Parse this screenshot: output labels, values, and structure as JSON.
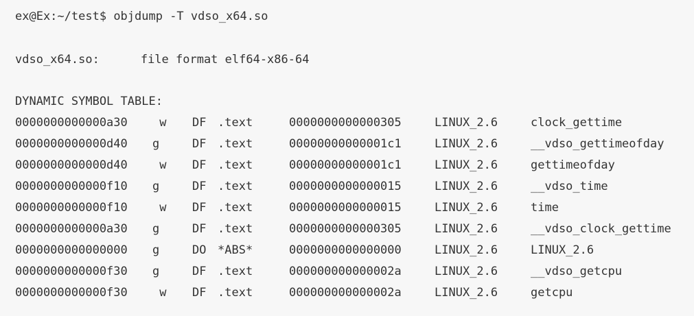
{
  "terminal": {
    "prompt": "ex@Ex:~/test$",
    "command": "objdump -T vdso_x64.so",
    "file_name": "vdso_x64.so:",
    "file_format": "file format elf64-x86-64",
    "table_title": "DYNAMIC SYMBOL TABLE:",
    "rows": [
      {
        "addr": "0000000000000a30",
        "flag1": " w",
        "flag2": "DF",
        "section": ".text",
        "size": "0000000000000305",
        "version": "LINUX_2.6",
        "name": "clock_gettime"
      },
      {
        "addr": "0000000000000d40",
        "flag1": "g",
        "flag2": "DF",
        "section": ".text",
        "size": "00000000000001c1",
        "version": "LINUX_2.6",
        "name": "__vdso_gettimeofday"
      },
      {
        "addr": "0000000000000d40",
        "flag1": " w",
        "flag2": "DF",
        "section": ".text",
        "size": "00000000000001c1",
        "version": "LINUX_2.6",
        "name": "gettimeofday"
      },
      {
        "addr": "0000000000000f10",
        "flag1": "g",
        "flag2": "DF",
        "section": ".text",
        "size": "0000000000000015",
        "version": "LINUX_2.6",
        "name": "__vdso_time"
      },
      {
        "addr": "0000000000000f10",
        "flag1": " w",
        "flag2": "DF",
        "section": ".text",
        "size": "0000000000000015",
        "version": "LINUX_2.6",
        "name": "time"
      },
      {
        "addr": "0000000000000a30",
        "flag1": "g",
        "flag2": "DF",
        "section": ".text",
        "size": "0000000000000305",
        "version": "LINUX_2.6",
        "name": "__vdso_clock_gettime"
      },
      {
        "addr": "0000000000000000",
        "flag1": "g",
        "flag2": "DO",
        "section": "*ABS*",
        "size": "0000000000000000",
        "version": "LINUX_2.6",
        "name": "LINUX_2.6"
      },
      {
        "addr": "0000000000000f30",
        "flag1": "g",
        "flag2": "DF",
        "section": ".text",
        "size": "000000000000002a",
        "version": "LINUX_2.6",
        "name": "__vdso_getcpu"
      },
      {
        "addr": "0000000000000f30",
        "flag1": " w",
        "flag2": "DF",
        "section": ".text",
        "size": "000000000000002a",
        "version": "LINUX_2.6",
        "name": "getcpu"
      }
    ]
  }
}
